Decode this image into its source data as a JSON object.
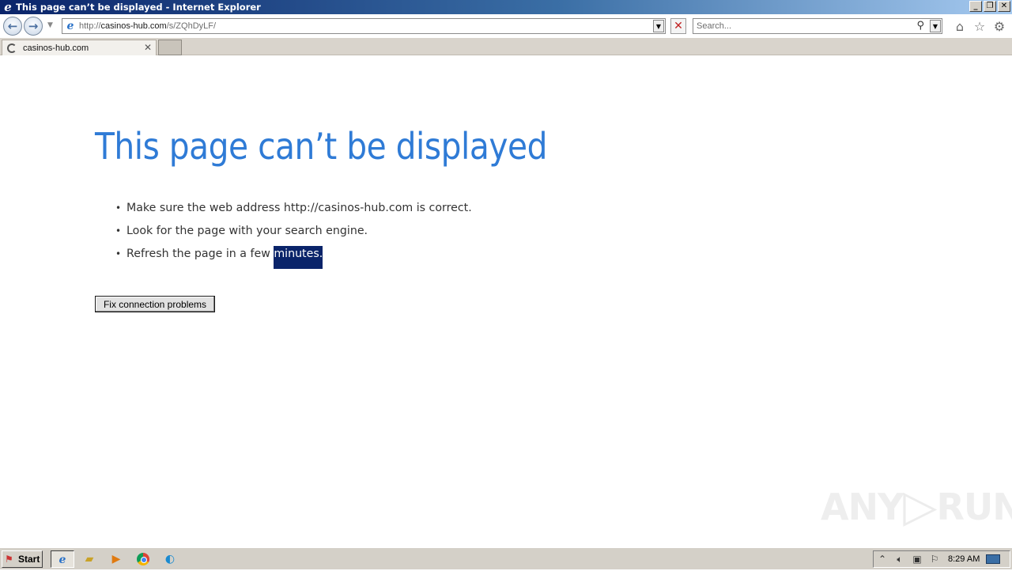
{
  "window": {
    "title": "This page can’t be displayed - Internet Explorer",
    "minimize": "_",
    "restore": "❐",
    "close": "✕"
  },
  "nav": {
    "address_prefix": "http://",
    "address_host": "casinos-hub.com",
    "address_path": "/s/ZQhDyLF/",
    "search_placeholder": "Search..."
  },
  "tabs": [
    {
      "label": "casinos-hub.com"
    }
  ],
  "page": {
    "heading": "This page can’t be displayed",
    "bullets": [
      "Make sure the web address http://casinos-hub.com is correct.",
      "Look for the page with your search engine."
    ],
    "bullet3_prefix": "Refresh the page in a few ",
    "bullet3_selected": "minutes.",
    "fix_button": "Fix connection problems"
  },
  "watermark": {
    "left": "ANY",
    "right": "RUN"
  },
  "taskbar": {
    "start_label": "Start",
    "clock": "8:29 AM"
  },
  "colors": {
    "heading": "#2f7bd6",
    "selection": "#0a246a",
    "titlebar": "#0a246a"
  }
}
